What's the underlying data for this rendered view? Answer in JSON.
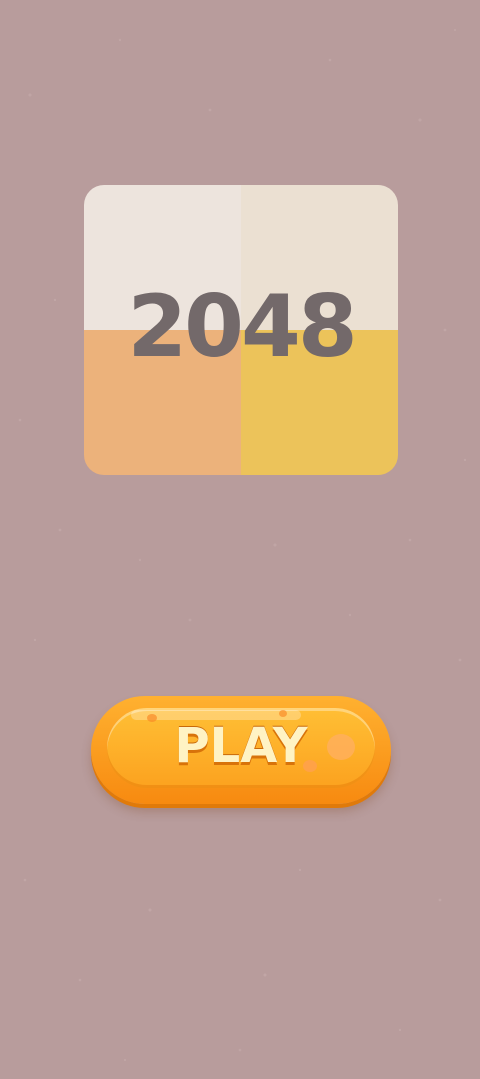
{
  "logo": {
    "text": "2048",
    "colors": {
      "top_left": "#ede4dd",
      "top_right": "#ebe0d2",
      "bottom_left": "#ecb27b",
      "bottom_right": "#ecc35a",
      "text": "#73696a"
    }
  },
  "play_button": {
    "label": "PLAY",
    "colors": {
      "outer": "#f78a10",
      "inner": "#ffbf35",
      "text": "#fff3c4"
    }
  },
  "background_color": "#b89c9c"
}
